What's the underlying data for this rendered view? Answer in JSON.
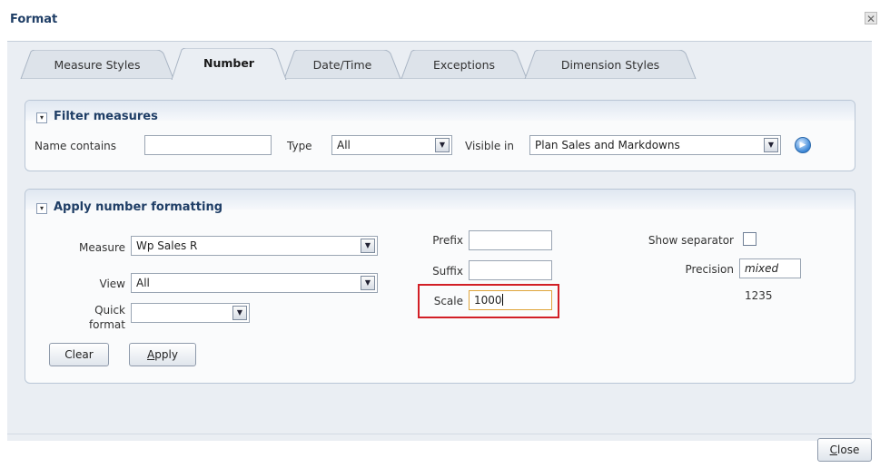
{
  "dialog": {
    "title": "Format",
    "close_glyph": "✕"
  },
  "tabs": [
    {
      "label": "Measure Styles",
      "active": false
    },
    {
      "label": "Number",
      "active": true
    },
    {
      "label": "Date/Time",
      "active": false
    },
    {
      "label": "Exceptions",
      "active": false
    },
    {
      "label": "Dimension Styles",
      "active": false
    }
  ],
  "filter": {
    "title": "Filter measures",
    "name_contains_label": "Name contains",
    "name_contains_value": "",
    "type_label": "Type",
    "type_value": "All",
    "visible_in_label": "Visible in",
    "visible_in_value": "Plan Sales and Markdowns",
    "go_icon": "go-arrow-icon"
  },
  "apply": {
    "title": "Apply number formatting",
    "measure_label": "Measure",
    "measure_value": "Wp Sales R",
    "view_label": "View",
    "view_value": "All",
    "quick_label_1": "Quick",
    "quick_label_2": "format",
    "quick_value": "",
    "prefix_label": "Prefix",
    "prefix_value": "",
    "suffix_label": "Suffix",
    "suffix_value": "",
    "scale_label": "Scale",
    "scale_value": "1000",
    "show_separator_label": "Show separator",
    "show_separator_checked": false,
    "precision_label": "Precision",
    "precision_value": "mixed",
    "preview_value": "1235",
    "clear_label": "Clear",
    "apply_label_first": "A",
    "apply_label_rest": "pply"
  },
  "footer": {
    "close_first": "C",
    "close_rest": "lose"
  },
  "colors": {
    "highlight": "#d21f26",
    "title": "#1f3e66",
    "panel_border": "#b9c6d6"
  }
}
